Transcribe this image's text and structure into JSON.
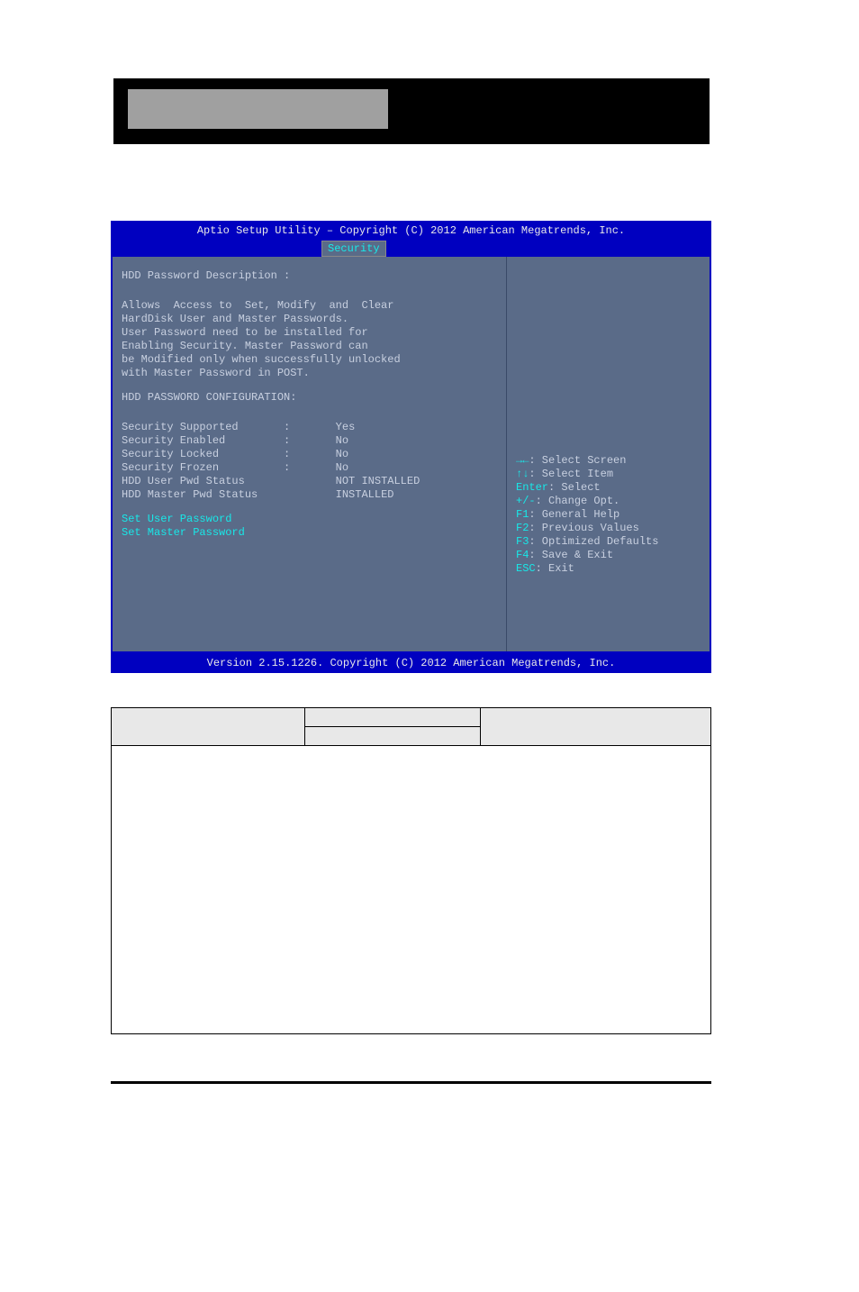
{
  "bios": {
    "title": "Aptio Setup Utility – Copyright (C) 2012 American Megatrends, Inc.",
    "tab": "Security",
    "desc_header": "HDD Password Description :",
    "desc_lines": [
      "Allows  Access to  Set, Modify  and  Clear",
      "HardDisk User and Master Passwords.",
      "User Password need to be installed for",
      "Enabling Security. Master Password can",
      "be Modified only when successfully unlocked",
      "with Master Password in POST."
    ],
    "config_header": "HDD PASSWORD CONFIGURATION:",
    "config": [
      {
        "label": "Security Supported",
        "sep": ":",
        "value": "Yes"
      },
      {
        "label": "Security Enabled",
        "sep": ":",
        "value": "No"
      },
      {
        "label": "Security Locked",
        "sep": ":",
        "value": "No"
      },
      {
        "label": "Security Frozen",
        "sep": ":",
        "value": "No"
      },
      {
        "label": "HDD User Pwd Status",
        "sep": "",
        "value": "NOT INSTALLED"
      },
      {
        "label": "HDD Master Pwd Status",
        "sep": "",
        "value": "INSTALLED"
      }
    ],
    "actions": {
      "set_user": "Set User Password",
      "set_master": "Set Master Password"
    },
    "help": [
      {
        "key": "→←",
        "text": ": Select Screen"
      },
      {
        "key": "↑↓",
        "text": ": Select Item"
      },
      {
        "key": "Enter",
        "text": ": Select"
      },
      {
        "key": "+/-",
        "text": ": Change Opt."
      },
      {
        "key": "F1",
        "text": ": General Help"
      },
      {
        "key": "F2",
        "text": ": Previous Values"
      },
      {
        "key": "F3",
        "text": ": Optimized Defaults"
      },
      {
        "key": "F4",
        "text": ": Save & Exit"
      },
      {
        "key": "ESC",
        "text": ": Exit"
      }
    ],
    "footer": "Version 2.15.1226. Copyright (C) 2012 American Megatrends, Inc."
  },
  "table": {
    "headers": {
      "c1": "",
      "c2a": "",
      "c2b": "",
      "c3": ""
    }
  }
}
